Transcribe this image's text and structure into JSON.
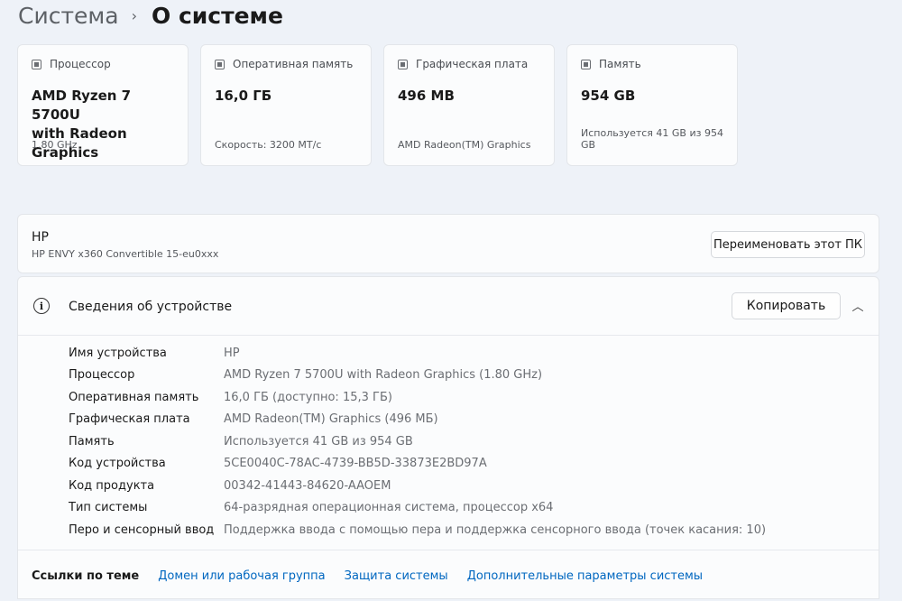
{
  "breadcrumb": {
    "parent": "Система",
    "separator": "›",
    "current": "О системе"
  },
  "cards": [
    {
      "icon": "processor-icon",
      "label": "Процессор",
      "value_line1": "AMD Ryzen 7 5700U",
      "value_line2": "with Radeon Graphics",
      "sub": "1.80 GHz"
    },
    {
      "icon": "memory-icon",
      "label": "Оперативная память",
      "value_line1": "16,0 ГБ",
      "value_line2": "",
      "sub": "Скорость: 3200 МТ/с"
    },
    {
      "icon": "gpu-icon",
      "label": "Графическая плата",
      "value_line1": "496 MB",
      "value_line2": "",
      "sub": "AMD Radeon(TM) Graphics"
    },
    {
      "icon": "storage-icon",
      "label": "Память",
      "value_line1": "954 GB",
      "value_line2": "",
      "sub": "Используется 41 GB из 954 GB"
    }
  ],
  "pc": {
    "name": "HP",
    "model": "HP ENVY x360 Convertible 15-eu0xxx",
    "rename_label": "Переименовать этот ПК"
  },
  "device_specs": {
    "title": "Сведения об устройстве",
    "copy_label": "Копировать",
    "rows": [
      {
        "key": "Имя устройства",
        "value": "HP"
      },
      {
        "key": "Процессор",
        "value": "AMD Ryzen 7 5700U with Radeon Graphics (1.80 GHz)"
      },
      {
        "key": "Оперативная память",
        "value": "16,0 ГБ (доступно: 15,3 ГБ)"
      },
      {
        "key": "Графическая плата",
        "value": "AMD Radeon(TM) Graphics (496 МБ)"
      },
      {
        "key": "Память",
        "value": "Используется 41 GB из 954 GB"
      },
      {
        "key": "Код устройства",
        "value": "5CE0040C-78AC-4739-BB5D-33873E2BD97A"
      },
      {
        "key": "Код продукта",
        "value": "00342-41443-84620-AAOEM"
      },
      {
        "key": "Тип системы",
        "value": "64-разрядная операционная система, процессор x64"
      },
      {
        "key": "Перо и сенсорный ввод",
        "value": "Поддержка ввода с помощью пера и поддержка сенсорного ввода (точек касания: 10)"
      }
    ]
  },
  "related_links": {
    "label": "Ссылки по теме",
    "links": [
      "Домен или рабочая группа",
      "Защита системы",
      "Дополнительные параметры системы"
    ]
  },
  "colors": {
    "accent_link": "#0067c0",
    "background": "#eef2f8",
    "card": "#fbfcfd"
  }
}
